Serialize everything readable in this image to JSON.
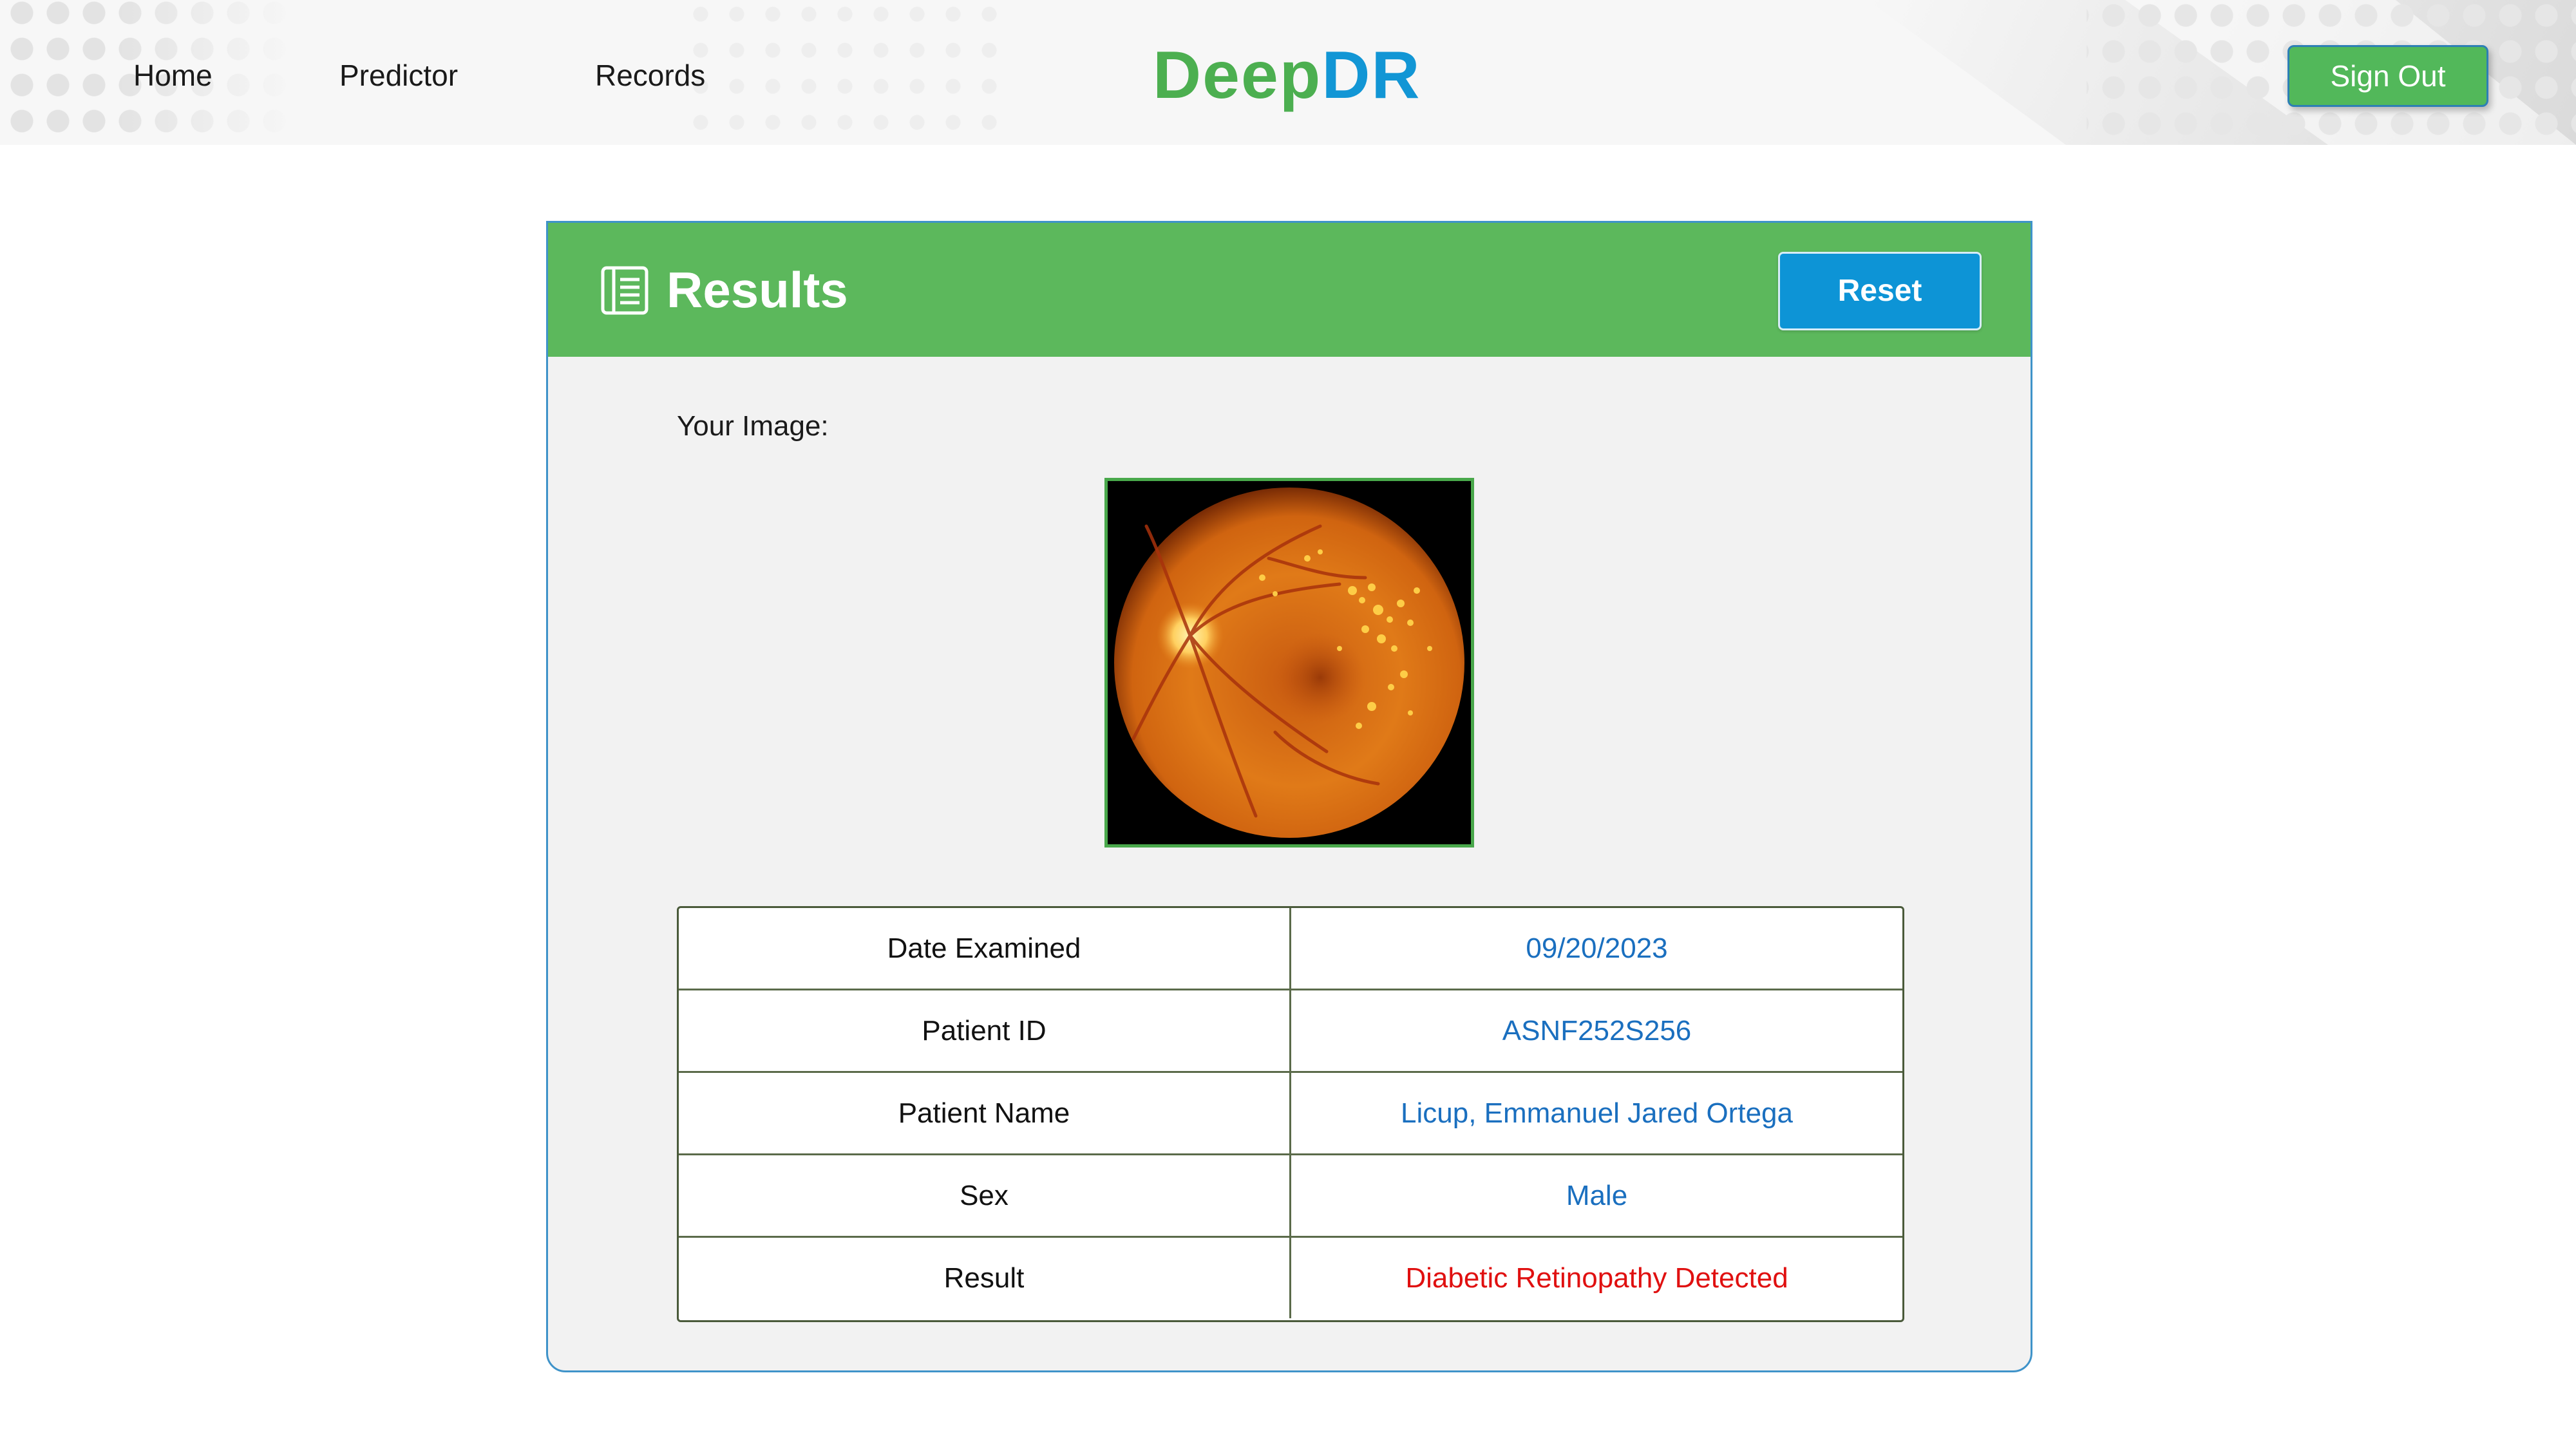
{
  "colors": {
    "brand_green": "#4caf50",
    "brand_blue": "#1296d5",
    "header_green": "#5cb85c",
    "reset_blue": "#0d94d6",
    "value_blue": "#1a6fbf",
    "alert_red": "#e01010"
  },
  "nav": {
    "home": "Home",
    "predictor": "Predictor",
    "records": "Records"
  },
  "logo": {
    "part1": "Deep",
    "part2": "DR"
  },
  "signout_label": "Sign Out",
  "results": {
    "title": "Results",
    "icon": "document-list-icon",
    "reset_label": "Reset",
    "image_label": "Your Image:",
    "image_icon": "retina-fundus-image",
    "rows": [
      {
        "label": "Date Examined",
        "value": "09/20/2023"
      },
      {
        "label": "Patient ID",
        "value": "ASNF252S256"
      },
      {
        "label": "Patient Name",
        "value": "Licup, Emmanuel Jared Ortega"
      },
      {
        "label": "Sex",
        "value": "Male"
      },
      {
        "label": "Result",
        "value": "Diabetic Retinopathy Detected"
      }
    ]
  }
}
